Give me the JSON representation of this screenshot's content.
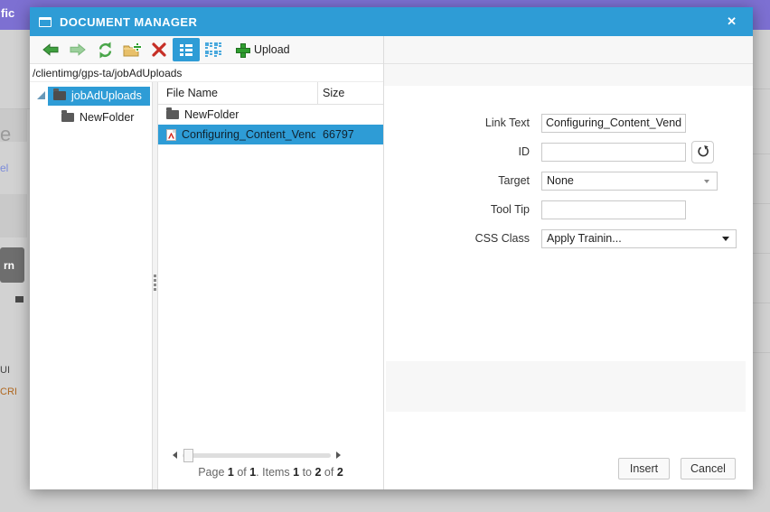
{
  "window": {
    "title": "DOCUMENT MANAGER",
    "close_glyph": "✕"
  },
  "toolbar": {
    "upload_label": "Upload",
    "icons": [
      "back-icon",
      "forward-icon",
      "refresh-icon",
      "new-folder-icon",
      "delete-icon",
      "list-view-icon",
      "grid-view-icon",
      "upload-plus-icon"
    ]
  },
  "path": {
    "value": "/clientimg/gps-ta/jobAdUploads"
  },
  "tree": {
    "items": [
      {
        "label": "jobAdUploads",
        "selected": true
      },
      {
        "label": "NewFolder",
        "selected": false
      }
    ]
  },
  "file_list": {
    "columns": [
      "File Name",
      "Size"
    ],
    "rows": [
      {
        "name": "NewFolder",
        "size": "",
        "type": "folder",
        "selected": false
      },
      {
        "name": "Configuring_Content_Vendo",
        "size": "66797",
        "type": "pdf",
        "selected": true
      }
    ],
    "pagination": {
      "parts": [
        "Page ",
        "1",
        " of ",
        "1",
        ". Items ",
        "1",
        " to ",
        "2",
        " of ",
        "2"
      ]
    }
  },
  "form": {
    "link_text": {
      "label": "Link Text",
      "value": "Configuring_Content_Vendor"
    },
    "id": {
      "label": "ID",
      "value": ""
    },
    "target": {
      "label": "Target",
      "value": "None"
    },
    "tooltip": {
      "label": "Tool Tip",
      "value": ""
    },
    "css_class": {
      "label": "CSS Class",
      "value": "Apply Trainin..."
    }
  },
  "buttons": {
    "insert": "Insert",
    "cancel": "Cancel"
  },
  "background": {
    "topbar_fragment": "fic",
    "fragments": {
      "f1": "e",
      "f2": "el",
      "button_label": "rn",
      "f3": "UI",
      "f4": "CRI"
    }
  },
  "colors": {
    "titlebar_blue": "#2e9cd6",
    "selection_blue": "#2e9cd6",
    "backdrop_purple": "#7d70d2",
    "toolbar_gray": "#f8f8f8",
    "pdf_red": "#d6281e",
    "action_green": "#3fa03f"
  }
}
